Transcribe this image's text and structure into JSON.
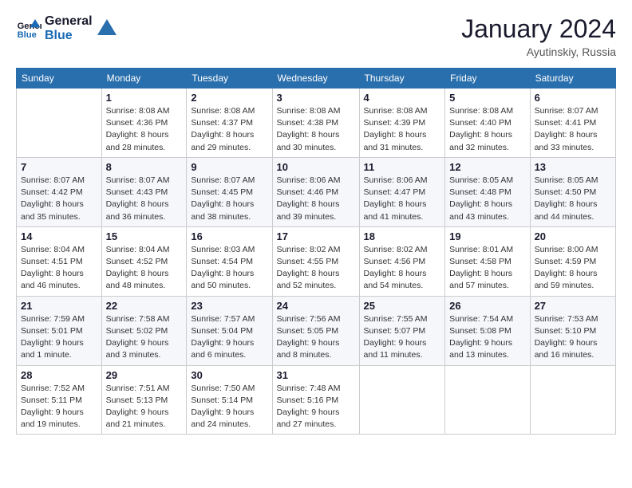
{
  "logo": {
    "text_general": "General",
    "text_blue": "Blue"
  },
  "header": {
    "month_year": "January 2024",
    "location": "Ayutinskiy, Russia"
  },
  "days_of_week": [
    "Sunday",
    "Monday",
    "Tuesday",
    "Wednesday",
    "Thursday",
    "Friday",
    "Saturday"
  ],
  "weeks": [
    [
      {
        "day": "",
        "info": ""
      },
      {
        "day": "1",
        "info": "Sunrise: 8:08 AM\nSunset: 4:36 PM\nDaylight: 8 hours\nand 28 minutes."
      },
      {
        "day": "2",
        "info": "Sunrise: 8:08 AM\nSunset: 4:37 PM\nDaylight: 8 hours\nand 29 minutes."
      },
      {
        "day": "3",
        "info": "Sunrise: 8:08 AM\nSunset: 4:38 PM\nDaylight: 8 hours\nand 30 minutes."
      },
      {
        "day": "4",
        "info": "Sunrise: 8:08 AM\nSunset: 4:39 PM\nDaylight: 8 hours\nand 31 minutes."
      },
      {
        "day": "5",
        "info": "Sunrise: 8:08 AM\nSunset: 4:40 PM\nDaylight: 8 hours\nand 32 minutes."
      },
      {
        "day": "6",
        "info": "Sunrise: 8:07 AM\nSunset: 4:41 PM\nDaylight: 8 hours\nand 33 minutes."
      }
    ],
    [
      {
        "day": "7",
        "info": "Sunrise: 8:07 AM\nSunset: 4:42 PM\nDaylight: 8 hours\nand 35 minutes."
      },
      {
        "day": "8",
        "info": "Sunrise: 8:07 AM\nSunset: 4:43 PM\nDaylight: 8 hours\nand 36 minutes."
      },
      {
        "day": "9",
        "info": "Sunrise: 8:07 AM\nSunset: 4:45 PM\nDaylight: 8 hours\nand 38 minutes."
      },
      {
        "day": "10",
        "info": "Sunrise: 8:06 AM\nSunset: 4:46 PM\nDaylight: 8 hours\nand 39 minutes."
      },
      {
        "day": "11",
        "info": "Sunrise: 8:06 AM\nSunset: 4:47 PM\nDaylight: 8 hours\nand 41 minutes."
      },
      {
        "day": "12",
        "info": "Sunrise: 8:05 AM\nSunset: 4:48 PM\nDaylight: 8 hours\nand 43 minutes."
      },
      {
        "day": "13",
        "info": "Sunrise: 8:05 AM\nSunset: 4:50 PM\nDaylight: 8 hours\nand 44 minutes."
      }
    ],
    [
      {
        "day": "14",
        "info": "Sunrise: 8:04 AM\nSunset: 4:51 PM\nDaylight: 8 hours\nand 46 minutes."
      },
      {
        "day": "15",
        "info": "Sunrise: 8:04 AM\nSunset: 4:52 PM\nDaylight: 8 hours\nand 48 minutes."
      },
      {
        "day": "16",
        "info": "Sunrise: 8:03 AM\nSunset: 4:54 PM\nDaylight: 8 hours\nand 50 minutes."
      },
      {
        "day": "17",
        "info": "Sunrise: 8:02 AM\nSunset: 4:55 PM\nDaylight: 8 hours\nand 52 minutes."
      },
      {
        "day": "18",
        "info": "Sunrise: 8:02 AM\nSunset: 4:56 PM\nDaylight: 8 hours\nand 54 minutes."
      },
      {
        "day": "19",
        "info": "Sunrise: 8:01 AM\nSunset: 4:58 PM\nDaylight: 8 hours\nand 57 minutes."
      },
      {
        "day": "20",
        "info": "Sunrise: 8:00 AM\nSunset: 4:59 PM\nDaylight: 8 hours\nand 59 minutes."
      }
    ],
    [
      {
        "day": "21",
        "info": "Sunrise: 7:59 AM\nSunset: 5:01 PM\nDaylight: 9 hours\nand 1 minute."
      },
      {
        "day": "22",
        "info": "Sunrise: 7:58 AM\nSunset: 5:02 PM\nDaylight: 9 hours\nand 3 minutes."
      },
      {
        "day": "23",
        "info": "Sunrise: 7:57 AM\nSunset: 5:04 PM\nDaylight: 9 hours\nand 6 minutes."
      },
      {
        "day": "24",
        "info": "Sunrise: 7:56 AM\nSunset: 5:05 PM\nDaylight: 9 hours\nand 8 minutes."
      },
      {
        "day": "25",
        "info": "Sunrise: 7:55 AM\nSunset: 5:07 PM\nDaylight: 9 hours\nand 11 minutes."
      },
      {
        "day": "26",
        "info": "Sunrise: 7:54 AM\nSunset: 5:08 PM\nDaylight: 9 hours\nand 13 minutes."
      },
      {
        "day": "27",
        "info": "Sunrise: 7:53 AM\nSunset: 5:10 PM\nDaylight: 9 hours\nand 16 minutes."
      }
    ],
    [
      {
        "day": "28",
        "info": "Sunrise: 7:52 AM\nSunset: 5:11 PM\nDaylight: 9 hours\nand 19 minutes."
      },
      {
        "day": "29",
        "info": "Sunrise: 7:51 AM\nSunset: 5:13 PM\nDaylight: 9 hours\nand 21 minutes."
      },
      {
        "day": "30",
        "info": "Sunrise: 7:50 AM\nSunset: 5:14 PM\nDaylight: 9 hours\nand 24 minutes."
      },
      {
        "day": "31",
        "info": "Sunrise: 7:48 AM\nSunset: 5:16 PM\nDaylight: 9 hours\nand 27 minutes."
      },
      {
        "day": "",
        "info": ""
      },
      {
        "day": "",
        "info": ""
      },
      {
        "day": "",
        "info": ""
      }
    ]
  ]
}
